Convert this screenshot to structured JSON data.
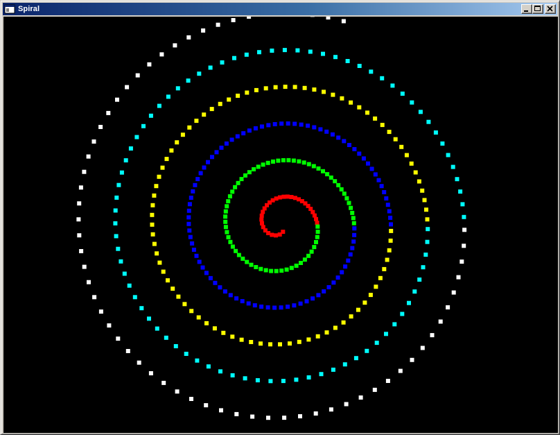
{
  "window": {
    "title": "Spiral",
    "minimize_icon": "minimize-icon",
    "maximize_icon": "maximize-icon",
    "close_icon": "close-icon",
    "app_icon": "window-app-icon"
  },
  "canvas": {
    "background": "#000000",
    "dot_colors": [
      "#ff0000",
      "#00ff00",
      "#0000ff",
      "#ffff00",
      "#00ffff",
      "#ffffff"
    ],
    "turns": [
      {
        "color": "red",
        "hex": "#ff0000"
      },
      {
        "color": "green",
        "hex": "#00ff00"
      },
      {
        "color": "blue",
        "hex": "#0000ff"
      },
      {
        "color": "yellow",
        "hex": "#ffff00"
      },
      {
        "color": "cyan",
        "hex": "#00ffff"
      },
      {
        "color": "white",
        "hex": "#ffffff"
      }
    ]
  }
}
